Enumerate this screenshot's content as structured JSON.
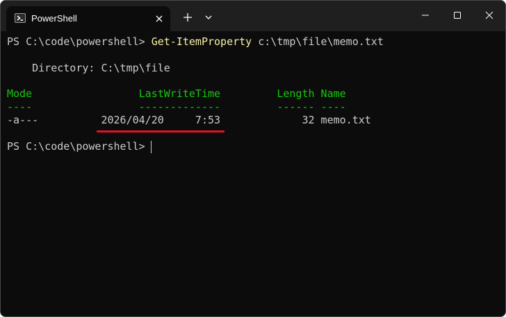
{
  "window": {
    "tab_title": "PowerShell",
    "new_tab_icon": "plus-icon",
    "dropdown_icon": "chevron-down-icon",
    "controls": [
      "minimize-icon",
      "maximize-icon",
      "close-icon"
    ]
  },
  "terminal": {
    "prompt": "PS C:\\code\\powershell> ",
    "command": "Get-ItemProperty",
    "command_args": " c:\\tmp\\file\\memo.txt",
    "directory_line": "    Directory: C:\\tmp\\file",
    "table": {
      "headers_line": "Mode                 LastWriteTime         Length Name",
      "dashes_line": "----                 -------------         ------ ----",
      "rows": [
        {
          "line": "-a---          2026/04/20     7:53             32 memo.txt"
        }
      ]
    },
    "prompt2": "PS C:\\code\\powershell> "
  },
  "colors": {
    "background": "#0c0c0c",
    "text": "#cccccc",
    "command": "#f9f1a5",
    "header": "#16c60c",
    "highlight_underline": "#e81123"
  }
}
